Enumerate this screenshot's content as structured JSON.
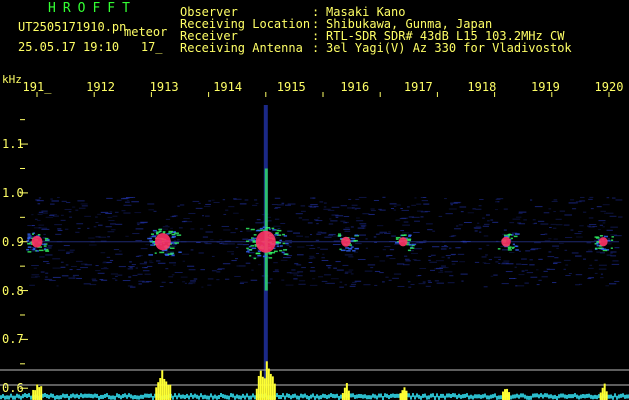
{
  "header": {
    "logo": "HROFFT",
    "file_name": "UT2505171910.pn",
    "event_tag": "meteor",
    "timestamp": "25.05.17 19:10",
    "count": "17_"
  },
  "info": [
    {
      "label": "Observer",
      "value": "Masaki Kano"
    },
    {
      "label": "Receiving Location",
      "value": "Shibukawa, Gunma, Japan"
    },
    {
      "label": "Receiver",
      "value": "RTL-SDR SDR# 43dB L15 103.2MHz CW"
    },
    {
      "label": "Receiving Antenna",
      "value": "3el Yagi(V) Az 330 for Vladivostok"
    }
  ],
  "info_separator": ":",
  "axes": {
    "unit_label": "kHz",
    "minutes": [
      "191_",
      "1912",
      "1913",
      "1914",
      "1915",
      "1916",
      "1917",
      "1918",
      "1919",
      "1920"
    ],
    "freq_ticks": [
      "1.1",
      "1.0",
      "0.9",
      "0.8",
      "0.7",
      "0.6"
    ]
  },
  "chart_data": {
    "type": "heatmap",
    "x_axis": "minute",
    "y_axis": "kHz",
    "ylim": [
      0.58,
      1.18
    ],
    "baseline_khz": 0.9,
    "echoes": [
      {
        "minute": 1910.0,
        "strength": 0.35
      },
      {
        "minute": 1912.2,
        "strength": 0.7
      },
      {
        "minute": 1914.0,
        "strength": 1.0
      },
      {
        "minute": 1915.4,
        "strength": 0.25
      },
      {
        "minute": 1916.4,
        "strength": 0.2
      },
      {
        "minute": 1918.2,
        "strength": 0.25
      },
      {
        "minute": 1919.9,
        "strength": 0.2
      }
    ],
    "colors": {
      "signal_hot": "#ff3366",
      "signal_mid": "#33ff66",
      "noise": "#2233aa",
      "power_bar": "#ffff33",
      "power_noise": "#33ddee"
    }
  }
}
